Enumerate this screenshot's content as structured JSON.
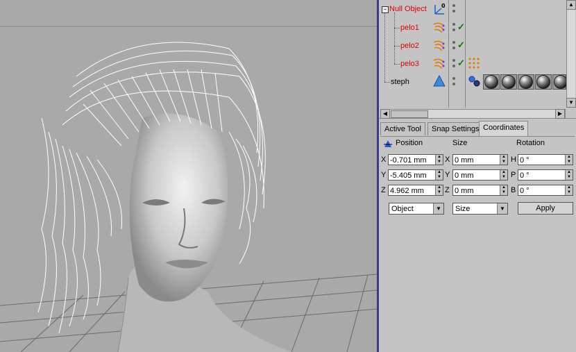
{
  "objects": [
    {
      "name": "Null Object",
      "color": "#e00000"
    },
    {
      "name": "pelo1",
      "color": "#e00000"
    },
    {
      "name": "pelo2",
      "color": "#e00000"
    },
    {
      "name": "pelo3",
      "color": "#e00000"
    },
    {
      "name": "steph",
      "color": "#000000"
    }
  ],
  "tabs": [
    "Active Tool",
    "Snap Settings",
    "Coordinates"
  ],
  "active_tab": "Coordinates",
  "coordinates": {
    "headers": {
      "position": "Position",
      "size": "Size",
      "rotation": "Rotation"
    },
    "position": {
      "x_label": "X",
      "y_label": "Y",
      "z_label": "Z",
      "x": "-0.701 mm",
      "y": "-5.405 mm",
      "z": "4.962 mm"
    },
    "size": {
      "x_label": "X",
      "y_label": "Y",
      "z_label": "Z",
      "x": "0 mm",
      "y": "0 mm",
      "z": "0 mm"
    },
    "rotation": {
      "h_label": "H",
      "p_label": "P",
      "b_label": "B",
      "h": "0 °",
      "p": "0 °",
      "b": "0 °"
    },
    "mode_select": "Object",
    "size_select": "Size",
    "apply_label": "Apply"
  }
}
